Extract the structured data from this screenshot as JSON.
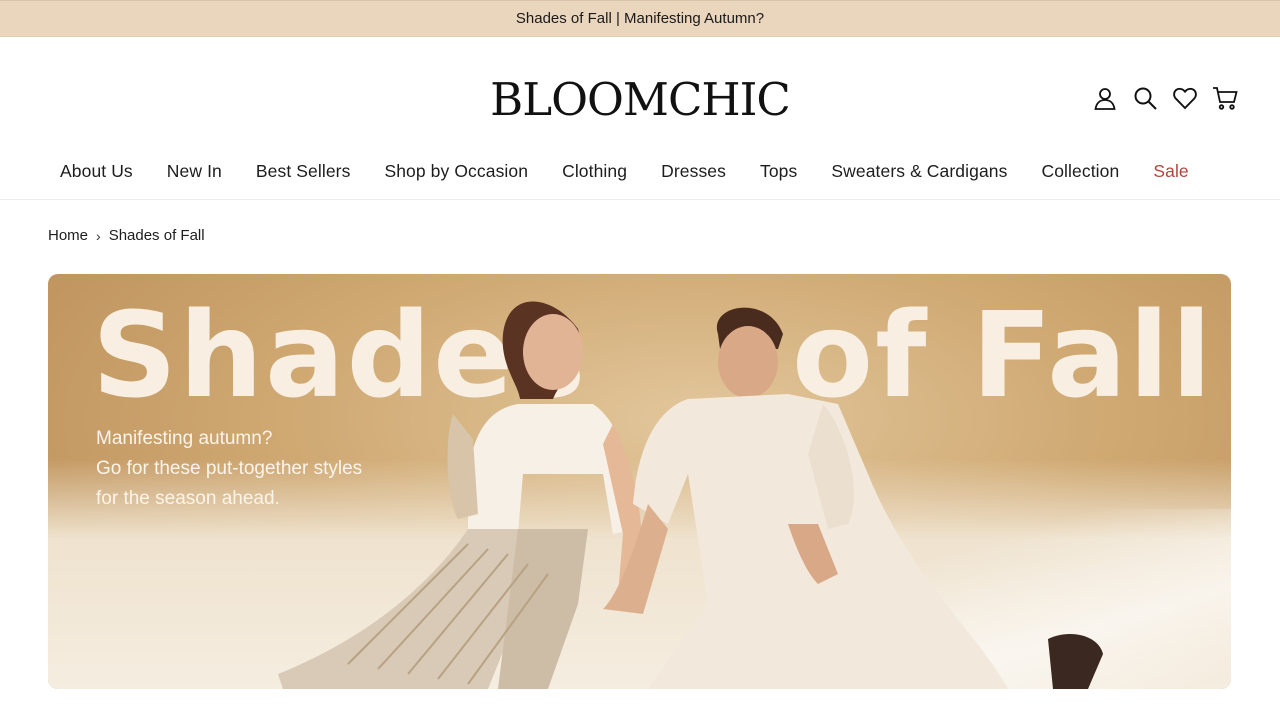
{
  "announcement": "Shades of Fall | Manifesting Autumn?",
  "brand": {
    "logo": "BLOOMCHIC"
  },
  "header_icons": [
    "account-icon",
    "search-icon",
    "wishlist-heart-icon",
    "cart-icon"
  ],
  "nav": {
    "items": [
      {
        "label": "About Us"
      },
      {
        "label": "New In"
      },
      {
        "label": "Best Sellers"
      },
      {
        "label": "Shop by Occasion"
      },
      {
        "label": "Clothing"
      },
      {
        "label": "Dresses"
      },
      {
        "label": "Tops"
      },
      {
        "label": "Sweaters & Cardigans"
      },
      {
        "label": "Collection"
      },
      {
        "label": "Sale"
      }
    ]
  },
  "breadcrumb": {
    "home": "Home",
    "separator": "›",
    "current": "Shades of Fall"
  },
  "hero": {
    "title_part1": "Shades",
    "title_part2": "of Fall",
    "subtitle_lines": [
      "Manifesting autumn?",
      "Go for these put-together styles",
      "for the season ahead."
    ]
  },
  "colors": {
    "announcement_bg": "#ead5bd",
    "sale": "#b0473a",
    "hero_text": "#f8efe2"
  }
}
